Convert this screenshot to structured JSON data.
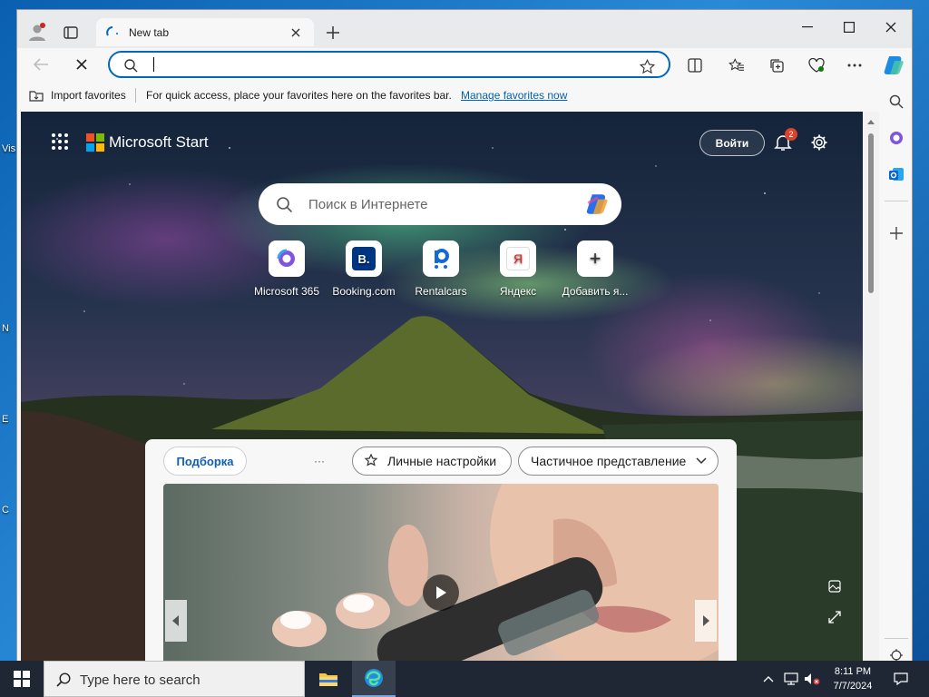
{
  "desktop": {
    "icons": [
      "Vis",
      "N",
      "E",
      "C"
    ]
  },
  "browser": {
    "tab": {
      "title": "New tab"
    },
    "omnibox": {
      "value": "",
      "placeholder": ""
    },
    "favorites_bar": {
      "import_label": "Import favorites",
      "hint": "For quick access, place your favorites here on the favorites bar.",
      "manage_link": "Manage favorites now"
    }
  },
  "start_page": {
    "brand": "Microsoft Start",
    "sign_in": "Войти",
    "notifications_count": "2",
    "search_placeholder": "Поиск в Интернете",
    "quick_links": [
      {
        "label": "Microsoft 365",
        "icon": "microsoft-365-icon"
      },
      {
        "label": "Booking.com",
        "icon": "booking-icon",
        "glyph": "B."
      },
      {
        "label": "Rentalcars",
        "icon": "rentalcars-icon"
      },
      {
        "label": "Яндекс",
        "icon": "yandex-icon",
        "glyph": "Я"
      },
      {
        "label": "Добавить я...",
        "icon": "add-icon",
        "glyph": "+"
      }
    ],
    "feed": {
      "tab": "Подборка",
      "more": "···",
      "personalize": "Личные настройки",
      "layout": "Частичное представление"
    }
  },
  "taskbar": {
    "search_placeholder": "Type here to search",
    "time": "8:11 PM",
    "date": "7/7/2024"
  },
  "colors": {
    "accent": "#0067c0",
    "link": "#0063b1",
    "badge": "#d9442a"
  }
}
